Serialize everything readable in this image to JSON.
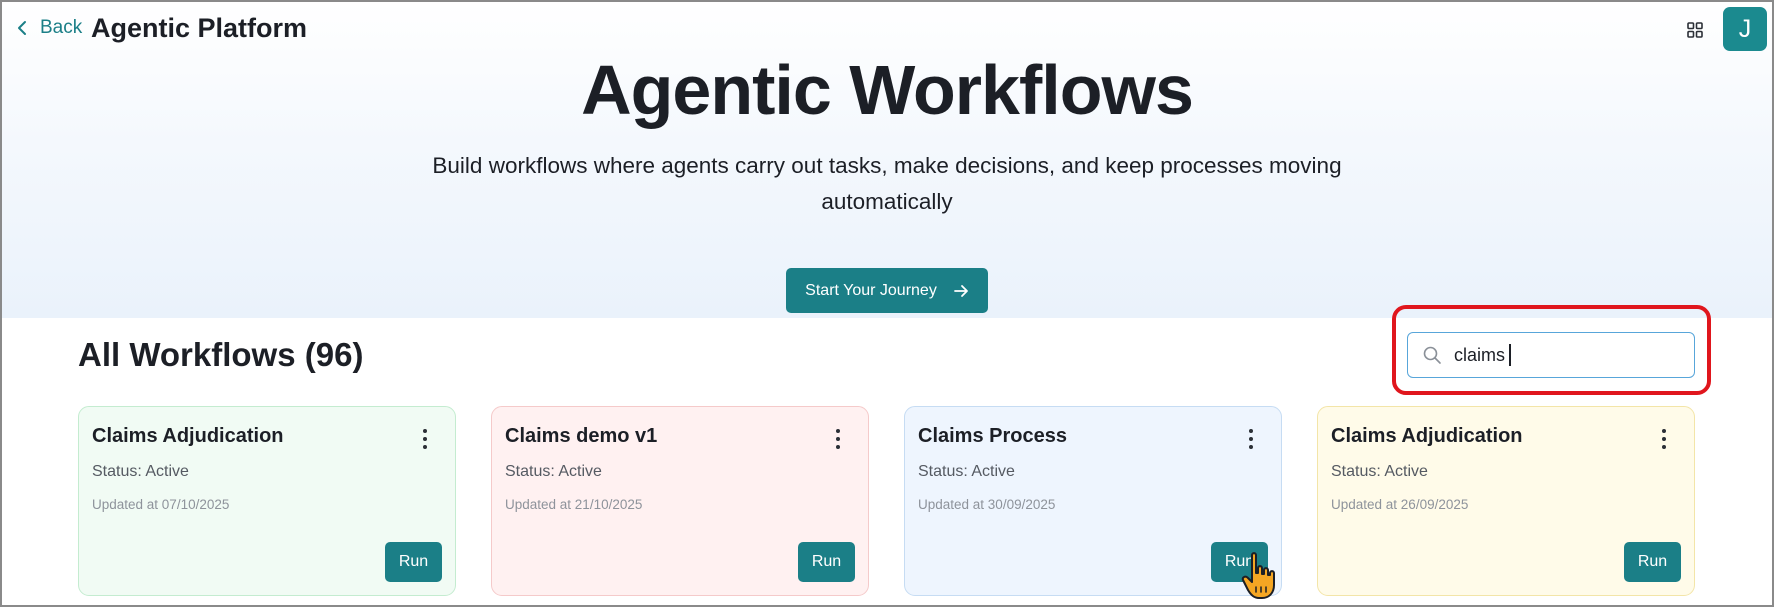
{
  "header": {
    "back_label": "Back",
    "app_title": "Agentic Platform",
    "avatar_initial": "J"
  },
  "hero": {
    "title": "Agentic Workflows",
    "subtitle": "Build workflows where agents carry out tasks, make decisions, and keep processes moving automatically",
    "cta_label": "Start Your Journey"
  },
  "workflows": {
    "section_title": "All Workflows (96)",
    "search": {
      "value": "claims",
      "placeholder": ""
    },
    "cards": [
      {
        "title": "Claims Adjudication",
        "status": "Status: Active",
        "updated": "Updated at 07/10/2025",
        "run_label": "Run"
      },
      {
        "title": "Claims demo v1",
        "status": "Status: Active",
        "updated": "Updated at 21/10/2025",
        "run_label": "Run"
      },
      {
        "title": "Claims Process",
        "status": "Status: Active",
        "updated": "Updated at 30/09/2025",
        "run_label": "Run"
      },
      {
        "title": "Claims Adjudication",
        "status": "Status: Active",
        "updated": "Updated at 26/09/2025",
        "run_label": "Run"
      }
    ]
  },
  "colors": {
    "accent": "#1b7f87",
    "card_green_bg": "#f1fbf4",
    "card_pink_bg": "#fff1f1",
    "card_blue_bg": "#eef5fe",
    "card_yellow_bg": "#fffbe9",
    "highlight": "#e0161d"
  },
  "icons": [
    "chevron-left-icon",
    "grid-icon",
    "arrow-right-icon",
    "search-icon",
    "kebab-menu-icon",
    "hand-pointer-icon"
  ]
}
